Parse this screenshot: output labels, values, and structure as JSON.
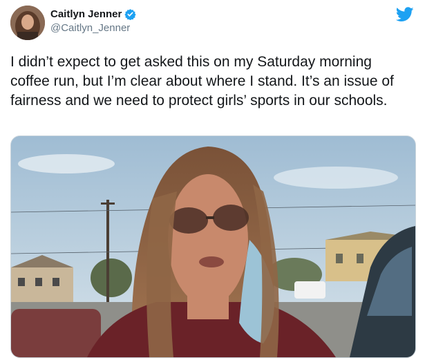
{
  "tweet": {
    "display_name": "Caitlyn Jenner",
    "handle": "@Caitlyn_Jenner",
    "text": "I didn’t expect to get asked this on my Saturday morning coffee run, but I’m clear about where I stand. It’s an issue of fairness and we need to protect girls’ sports in our schools."
  },
  "icons": {
    "verified": "verified-badge-icon",
    "brand": "twitter-bird-icon"
  },
  "colors": {
    "brand_blue": "#1da1f2",
    "handle_gray": "#657786",
    "text": "#14171a"
  }
}
